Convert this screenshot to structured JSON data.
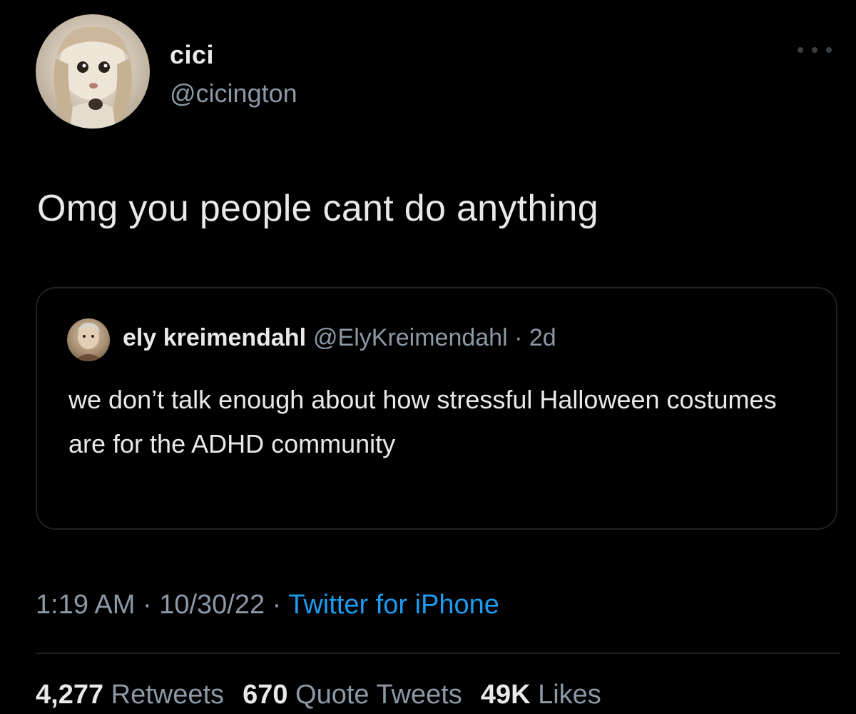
{
  "author": {
    "display_name": "cici",
    "handle": "@cicington",
    "avatar_icon": "doll-avatar-icon"
  },
  "menu": {
    "icon": "more-options-icon"
  },
  "tweet": {
    "text": "Omg you people cant do anything"
  },
  "quoted_tweet": {
    "display_name": "ely kreimendahl",
    "handle": "@ElyKreimendahl",
    "separator": " · ",
    "age": "2d",
    "text": "we don’t talk enough about how stressful Halloween costumes are for the ADHD community",
    "avatar_icon": "user-avatar-icon"
  },
  "meta": {
    "time": "1:19 AM",
    "sep1": " · ",
    "date": "10/30/22",
    "sep2": " · ",
    "source": "Twitter for iPhone"
  },
  "stats": {
    "retweets_count": "4,277",
    "retweets_label": "Retweets",
    "quotes_count": "670",
    "quotes_label": "Quote Tweets",
    "likes_count": "49K",
    "likes_label": "Likes"
  },
  "colors": {
    "background": "#000000",
    "primary_text": "#e7e9ea",
    "secondary_text": "#8b98a5",
    "link": "#1d9bf0",
    "border": "#1e2225"
  }
}
